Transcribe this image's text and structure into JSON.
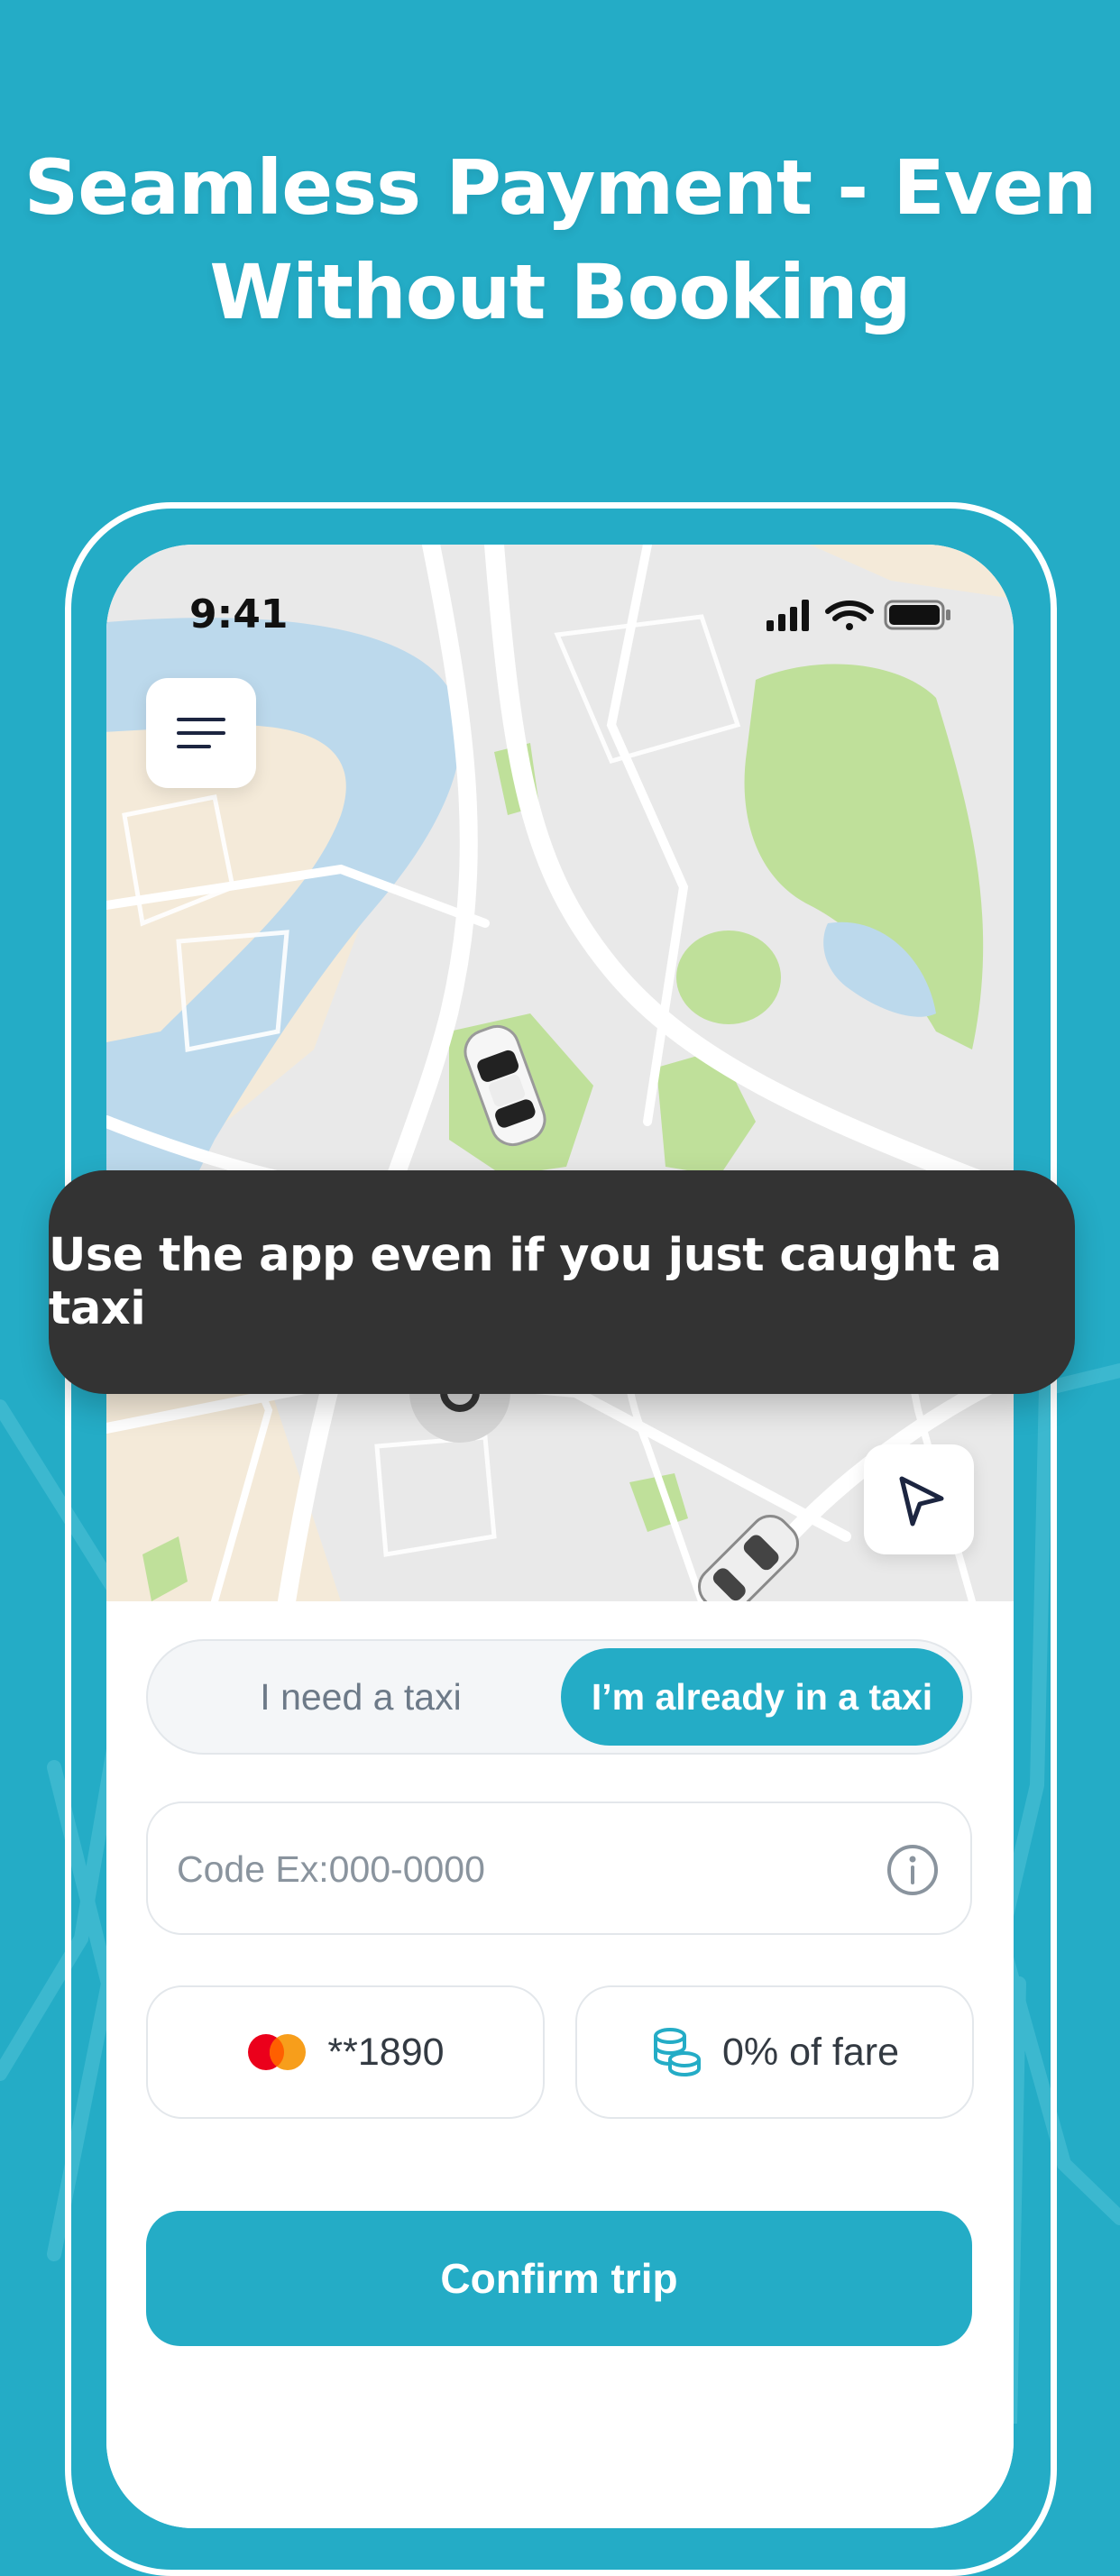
{
  "headline": {
    "line1": "Seamless Payment - Even",
    "line2": "Without Booking"
  },
  "status_bar": {
    "time": "9:41",
    "icons": [
      "signal-icon",
      "wifi-icon",
      "battery-icon"
    ]
  },
  "map": {
    "icons": [
      "menu-icon",
      "taxi-car-icon",
      "location-arrow-icon",
      "pickup-pin-icon"
    ]
  },
  "banner": {
    "text": "Use the app even if you just caught a taxi"
  },
  "mode_toggle": {
    "options": [
      "I need a taxi",
      "I’m already in a taxi"
    ],
    "selected": "I’m already in a taxi"
  },
  "code_field": {
    "placeholder": "Code Ex:000-0000",
    "value": ""
  },
  "payment": {
    "card_label": "**1890",
    "card_icon": "mastercard-icon"
  },
  "fare": {
    "label": "0% of fare",
    "icon": "coins-icon"
  },
  "confirm_button": {
    "label": "Confirm trip"
  },
  "colors": {
    "accent": "#24acc6",
    "banner": "#333333",
    "map_water": "#bcd9ec",
    "map_park": "#bfe09a",
    "map_land": "#e9e9e9"
  }
}
